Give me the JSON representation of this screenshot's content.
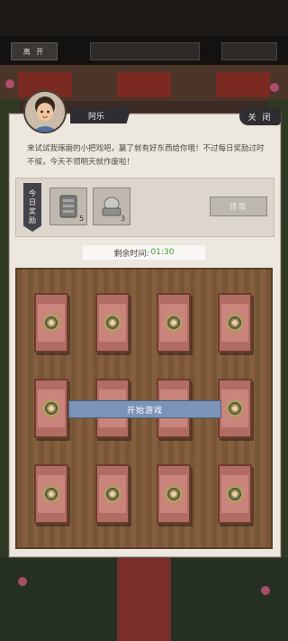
{
  "top_bar": {
    "leave_label": "离 开",
    "title_label": "",
    "right_label": ""
  },
  "npc": {
    "name": "阿乐",
    "close_label": "关 闭",
    "dialog": "来试试我琢磨的小把戏吧，赢了就有好东西给你哦！不过每日奖励过时不候，今天不领明天就作废啦！"
  },
  "rewards": {
    "tag": "今日奖励",
    "items": [
      {
        "icon": "scroll-pouch-icon",
        "count": "5"
      },
      {
        "icon": "stone-ingot-icon",
        "count": "3"
      }
    ],
    "claim_label": "领取"
  },
  "timer": {
    "label": "剩余时间:",
    "value": "01:30",
    "value_color": "#3d9b3a"
  },
  "game": {
    "start_label": "开始游戏",
    "card_count": 12
  },
  "colors": {
    "start_button": "#7c93b8",
    "title_text": "#d62e26",
    "right_text": "#5b9b34"
  }
}
